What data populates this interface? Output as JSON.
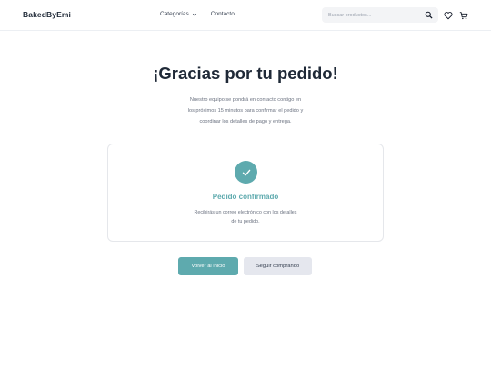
{
  "header": {
    "logo": "BakedByEmi",
    "nav": [
      {
        "label": "Categorías",
        "icon": "chevron-down-icon"
      },
      {
        "label": "Contacto"
      }
    ],
    "search_placeholder": "Buscar productos...",
    "icons": [
      "search-icon",
      "heart-icon",
      "cart-icon"
    ]
  },
  "main": {
    "title": "¡Gracias por tu pedido!",
    "subtitle_lines": [
      "Nuestro equipo se pondrá en contacto contigo en",
      "los próximos 15 minutos para confirmar el pedido y",
      "coordinar los detalles de pago y entrega."
    ],
    "card": {
      "icon": "check-icon",
      "title": "Pedido confirmado",
      "text_lines": [
        "Recibirás un correo electrónico con los detalles",
        "de tu pedido."
      ]
    },
    "buttons": {
      "primary": "Volver al inicio",
      "secondary": "Seguir comprando"
    }
  },
  "colors": {
    "accent": "#5eaaae",
    "secondary_button": "#e5e7ee",
    "text": "#1f2937",
    "muted": "#6b7280"
  }
}
